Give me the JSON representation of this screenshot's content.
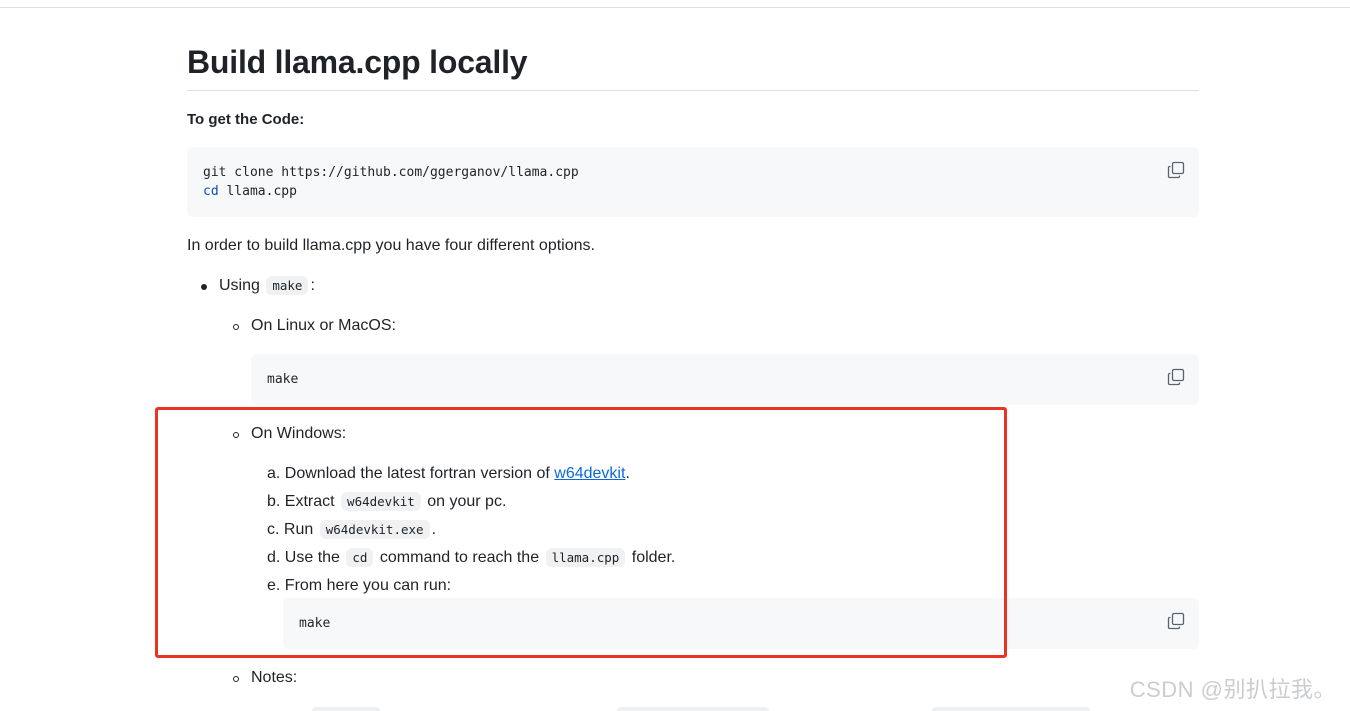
{
  "heading": "Build llama.cpp locally",
  "get_code_label": "To get the Code:",
  "code_clone": {
    "line1": "git clone https://github.com/ggerganov/llama.cpp",
    "line2_keyword": "cd",
    "line2_rest": " llama.cpp"
  },
  "intro": "In order to build llama.cpp you have four different options.",
  "using": {
    "prefix": "Using",
    "code": "make",
    "suffix": ":"
  },
  "linux_label": "On Linux or MacOS:",
  "linux_code": "make",
  "windows_label": "On Windows:",
  "windows_steps": {
    "a": {
      "marker": "a.",
      "text": "Download the latest fortran version of",
      "link": "w64devkit",
      "end": "."
    },
    "b": {
      "marker": "b.",
      "prefix": "Extract",
      "code": "w64devkit",
      "suffix": "on your pc."
    },
    "c": {
      "marker": "c.",
      "prefix": "Run",
      "code": "w64devkit.exe",
      "suffix": "."
    },
    "d": {
      "marker": "d.",
      "prefix": "Use the",
      "code1": "cd",
      "middle": "command to reach the",
      "code2": "llama.cpp",
      "suffix": "folder."
    },
    "e": {
      "marker": "e.",
      "text": "From here you can run:"
    }
  },
  "windows_code": "make",
  "notes_label": "Notes:",
  "watermark": "CSDN @别扒拉我。",
  "icons": {
    "copy": "copy-icon"
  },
  "colors": {
    "highlight_border": "#ea3323",
    "link": "#0969da",
    "code_bg": "#f6f8fa"
  }
}
